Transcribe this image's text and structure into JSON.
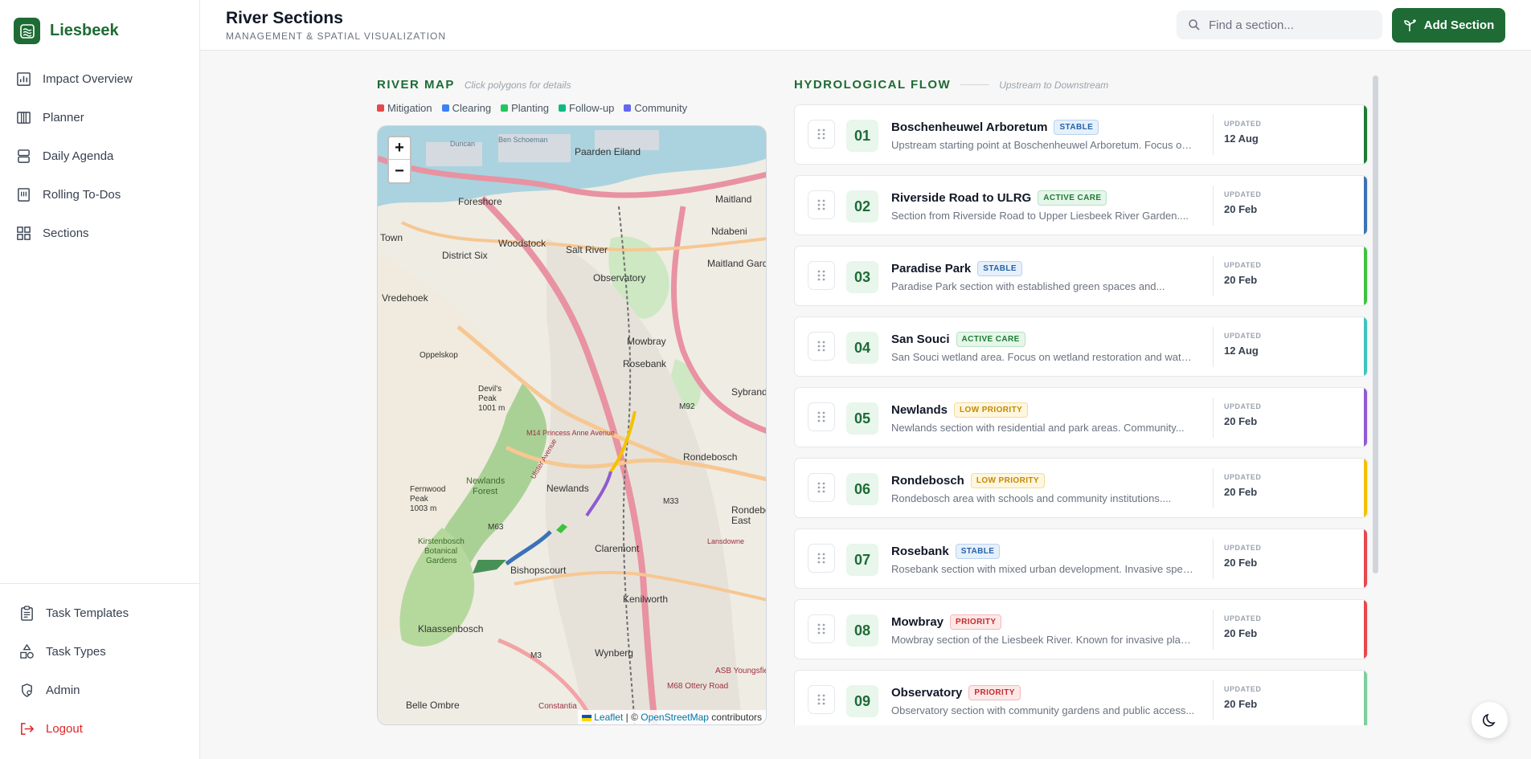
{
  "brand": {
    "name": "Liesbeek"
  },
  "nav": {
    "items": [
      {
        "label": "Impact Overview",
        "icon": "chart-bar-icon"
      },
      {
        "label": "Planner",
        "icon": "columns-icon"
      },
      {
        "label": "Daily Agenda",
        "icon": "rows-icon"
      },
      {
        "label": "Rolling To-Dos",
        "icon": "list-box-icon"
      },
      {
        "label": "Sections",
        "icon": "grid-icon"
      }
    ],
    "bottom": [
      {
        "label": "Task Templates",
        "icon": "clipboard-icon"
      },
      {
        "label": "Task Types",
        "icon": "shapes-icon"
      },
      {
        "label": "Admin",
        "icon": "shield-icon"
      },
      {
        "label": "Logout",
        "icon": "logout-icon"
      }
    ]
  },
  "header": {
    "title": "River Sections",
    "subtitle": "MANAGEMENT & SPATIAL VISUALIZATION",
    "search_placeholder": "Find a section...",
    "add_label": "Add Section"
  },
  "map": {
    "title": "RIVER MAP",
    "hint": "Click polygons for details",
    "legend": [
      {
        "label": "Mitigation",
        "color": "#e5484d"
      },
      {
        "label": "Clearing",
        "color": "#3b82f6"
      },
      {
        "label": "Planting",
        "color": "#22c55e"
      },
      {
        "label": "Follow-up",
        "color": "#10b981"
      },
      {
        "label": "Community",
        "color": "#6366f1"
      }
    ],
    "zoom_in": "+",
    "zoom_out": "−",
    "attribution_leaflet": "Leaflet",
    "attribution_sep": " | © ",
    "attribution_osm": "OpenStreetMap",
    "attribution_tail": " contributors",
    "places": [
      "Duncan Dock",
      "Ben Schoeman Dock",
      "Paarden Eiland",
      "Foreshore",
      "Town",
      "Woodstock",
      "Salt River",
      "Maitland",
      "Ndabeni",
      "District Six",
      "Maitland Garden Village",
      "Observatory",
      "Vredehoek",
      "Mowbray",
      "Rosebank",
      "Oppelskop",
      "Devil's Peak",
      "1001 m",
      "M92",
      "Rondebosch",
      "Newlands",
      "Newlands Forest",
      "M33",
      "M63",
      "Fernwood Peak",
      "1003 m",
      "Kirstenbosch Botanical Gardens",
      "Claremont",
      "Bishopscourt",
      "Kenilworth",
      "Klaassenbosch",
      "Wynberg",
      "Belle Ombre",
      "Constantia",
      "M3",
      "M68 Ottery Road",
      "ASB Youngsfield",
      "Sybrand",
      "Rondebosch East",
      "M14 Princess Anne Avenue",
      "Ulster Avenue",
      "Lansdowne"
    ]
  },
  "flow": {
    "title": "HYDROLOGICAL FLOW",
    "hint": "Upstream to Downstream",
    "updated_label": "UPDATED",
    "sections": [
      {
        "num": "01",
        "name": "Boschenheuwel Arboretum",
        "status": "STABLE",
        "desc": "Upstream starting point at Boschenheuwel Arboretum. Focus on...",
        "updated": "12 Aug",
        "accent": "#1e7a32"
      },
      {
        "num": "02",
        "name": "Riverside Road to ULRG",
        "status": "ACTIVE CARE",
        "desc": "Section from Riverside Road to Upper Liesbeek River Garden....",
        "updated": "20 Feb",
        "accent": "#3b72b5"
      },
      {
        "num": "03",
        "name": "Paradise Park",
        "status": "STABLE",
        "desc": "Paradise Park section with established green spaces and...",
        "updated": "20 Feb",
        "accent": "#3ec23e"
      },
      {
        "num": "04",
        "name": "San Souci",
        "status": "ACTIVE CARE",
        "desc": "San Souci wetland area. Focus on wetland restoration and water...",
        "updated": "12 Aug",
        "accent": "#3fc4bd"
      },
      {
        "num": "05",
        "name": "Newlands",
        "status": "LOW PRIORITY",
        "desc": "Newlands section with residential and park areas. Community...",
        "updated": "20 Feb",
        "accent": "#8e5bd1"
      },
      {
        "num": "06",
        "name": "Rondebosch",
        "status": "LOW PRIORITY",
        "desc": "Rondebosch area with schools and community institutions....",
        "updated": "20 Feb",
        "accent": "#f2c200"
      },
      {
        "num": "07",
        "name": "Rosebank",
        "status": "STABLE",
        "desc": "Rosebank section with mixed urban development. Invasive speci...",
        "updated": "20 Feb",
        "accent": "#e5484d"
      },
      {
        "num": "08",
        "name": "Mowbray",
        "status": "PRIORITY",
        "desc": "Mowbray section of the Liesbeek River. Known for invasive plant...",
        "updated": "20 Feb",
        "accent": "#e5484d"
      },
      {
        "num": "09",
        "name": "Observatory",
        "status": "PRIORITY",
        "desc": "Observatory section with community gardens and public access...",
        "updated": "20 Feb",
        "accent": "#7fcf9e"
      }
    ]
  },
  "colors": {
    "brand": "#1e6b35",
    "logout": "#dc2626"
  }
}
